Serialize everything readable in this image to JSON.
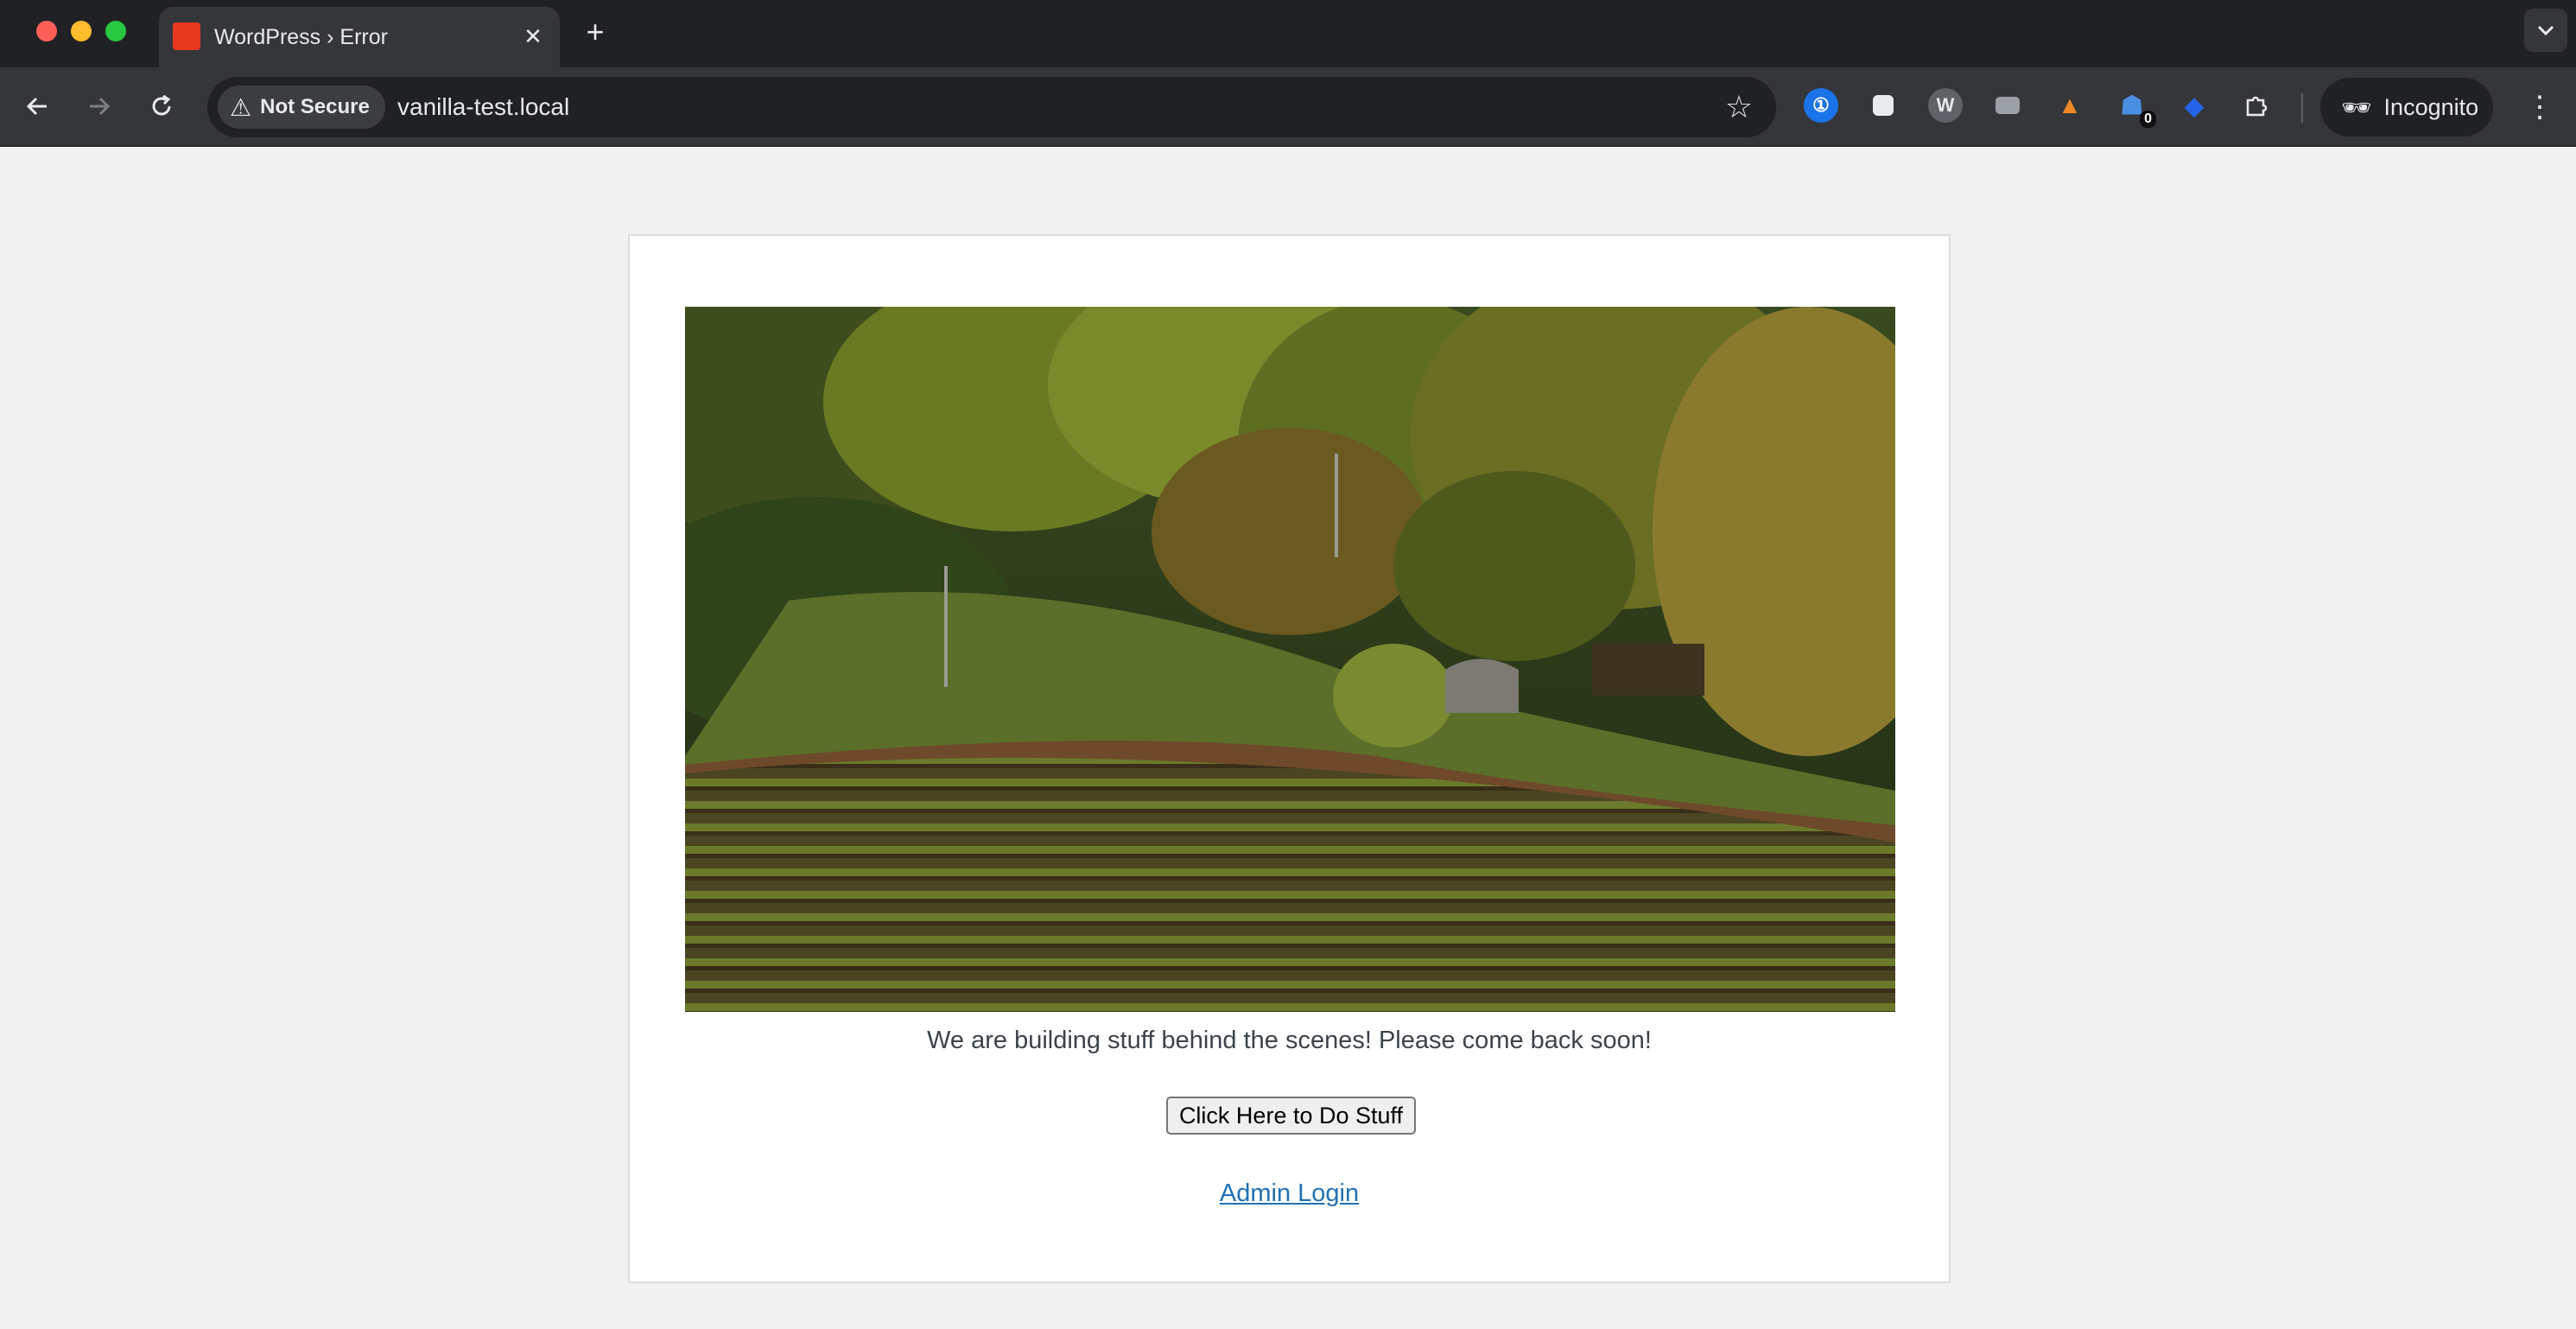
{
  "browser": {
    "tab_title": "WordPress › Error",
    "close_tab_glyph": "✕",
    "new_tab_glyph": "+",
    "security_label": "Not Secure",
    "url": "vanilla-test.local",
    "profile_label": "Incognito",
    "extensions": [
      {
        "name": "1password-extension-icon",
        "color": "#3b82f6"
      },
      {
        "name": "chat-extension-icon",
        "color": "#e8eaed"
      },
      {
        "name": "w-extension-icon",
        "color": "#9aa0a6"
      },
      {
        "name": "camera-extension-icon",
        "color": "#9aa0a6"
      },
      {
        "name": "fox-extension-icon",
        "color": "#f08a24"
      },
      {
        "name": "ghostery-extension-icon",
        "color": "#4a90e2",
        "badge": "0"
      },
      {
        "name": "tag-extension-icon",
        "color": "#2563eb"
      },
      {
        "name": "puzzle-extensions-icon",
        "color": "#e8eaed"
      }
    ]
  },
  "page": {
    "message": "We are building stuff behind the scenes! Please come back soon!",
    "button_label": "Click Here to Do Stuff",
    "admin_link": "Admin Login"
  },
  "colors": {
    "page_background": "#f1f1f1",
    "link": "#2271b1",
    "text": "#3c434a",
    "favicon": "#e8391f"
  }
}
